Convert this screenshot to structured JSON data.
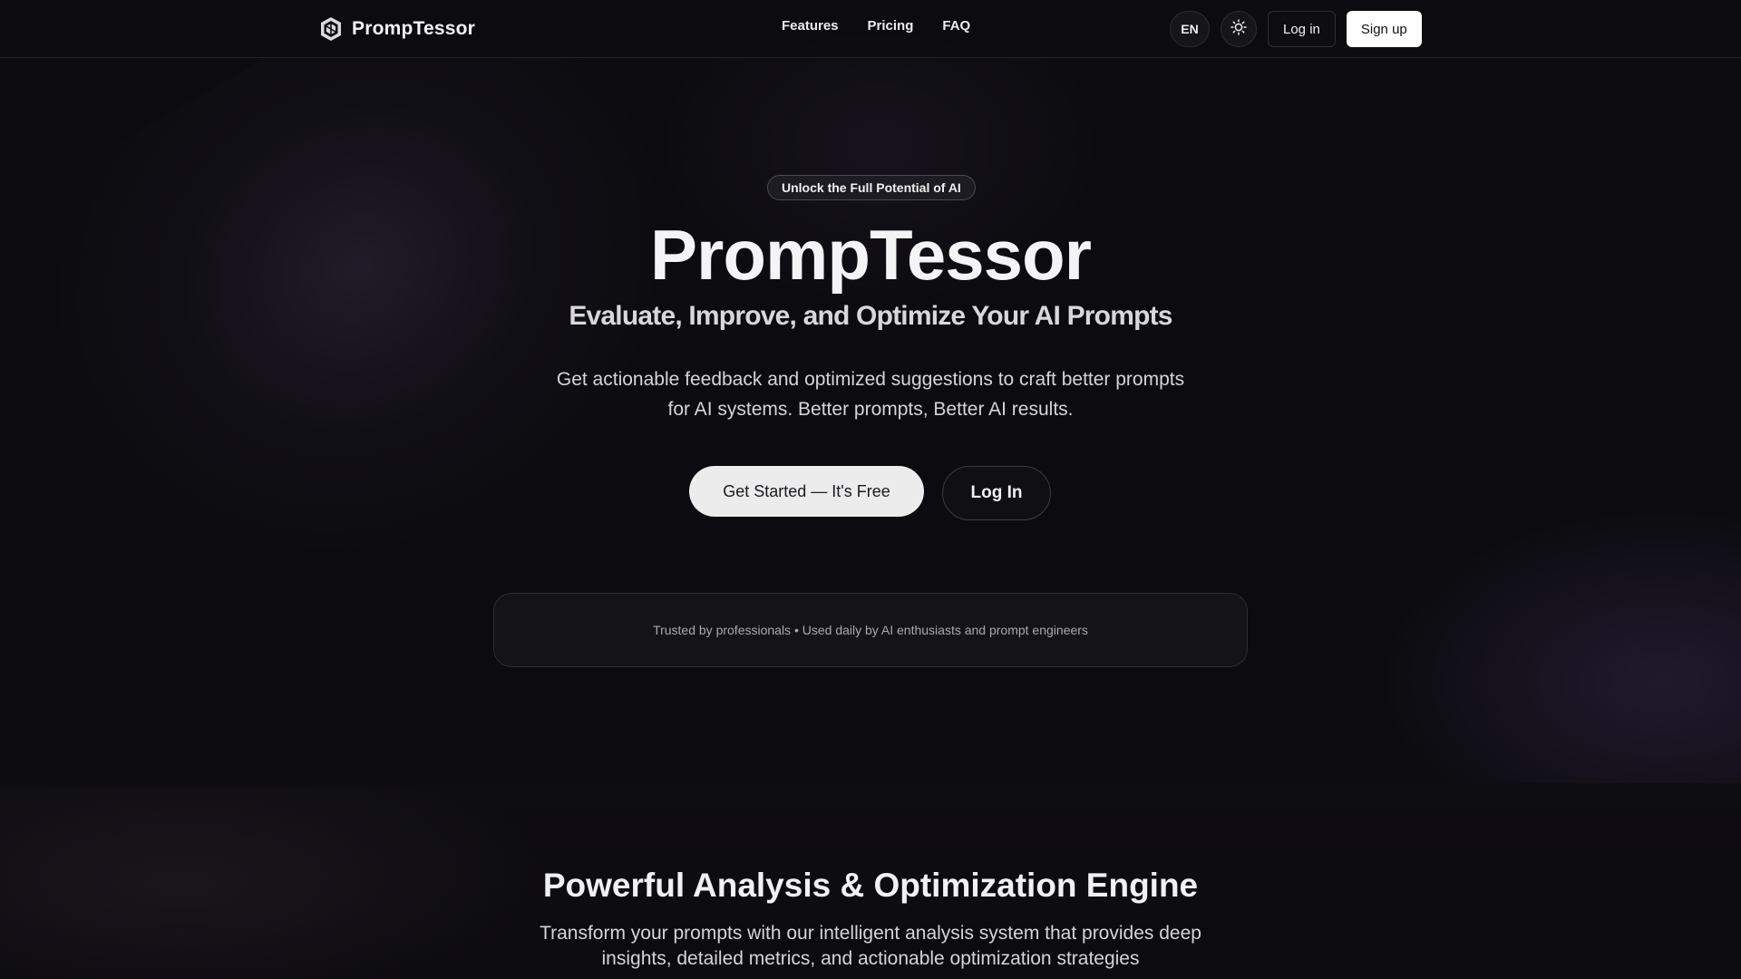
{
  "header": {
    "brand_name": "PrompTessor",
    "nav": [
      {
        "label": "Features"
      },
      {
        "label": "Pricing"
      },
      {
        "label": "FAQ"
      }
    ],
    "language_label": "EN",
    "theme_toggle_icon": "sun-icon",
    "login_label": "Log in",
    "signup_label": "Sign up"
  },
  "hero": {
    "badge": "Unlock the Full Potential of AI",
    "title": "PrompTessor",
    "subtitle": "Evaluate, Improve, and Optimize Your AI Prompts",
    "description": "Get actionable feedback and optimized suggestions to craft better prompts for AI systems. Better prompts, Better AI results.",
    "cta_primary": "Get Started — It's Free",
    "cta_secondary": "Log In",
    "trust_text": "Trusted by professionals • Used daily by AI enthusiasts and prompt engineers"
  },
  "features_section": {
    "title": "Powerful Analysis & Optimization Engine",
    "description": "Transform your prompts with our intelligent analysis system that provides deep insights, detailed metrics, and actionable optimization strategies"
  },
  "colors": {
    "background": "#0c0c10",
    "primary_button": "#ececed",
    "signup_button": "#ffffff"
  }
}
